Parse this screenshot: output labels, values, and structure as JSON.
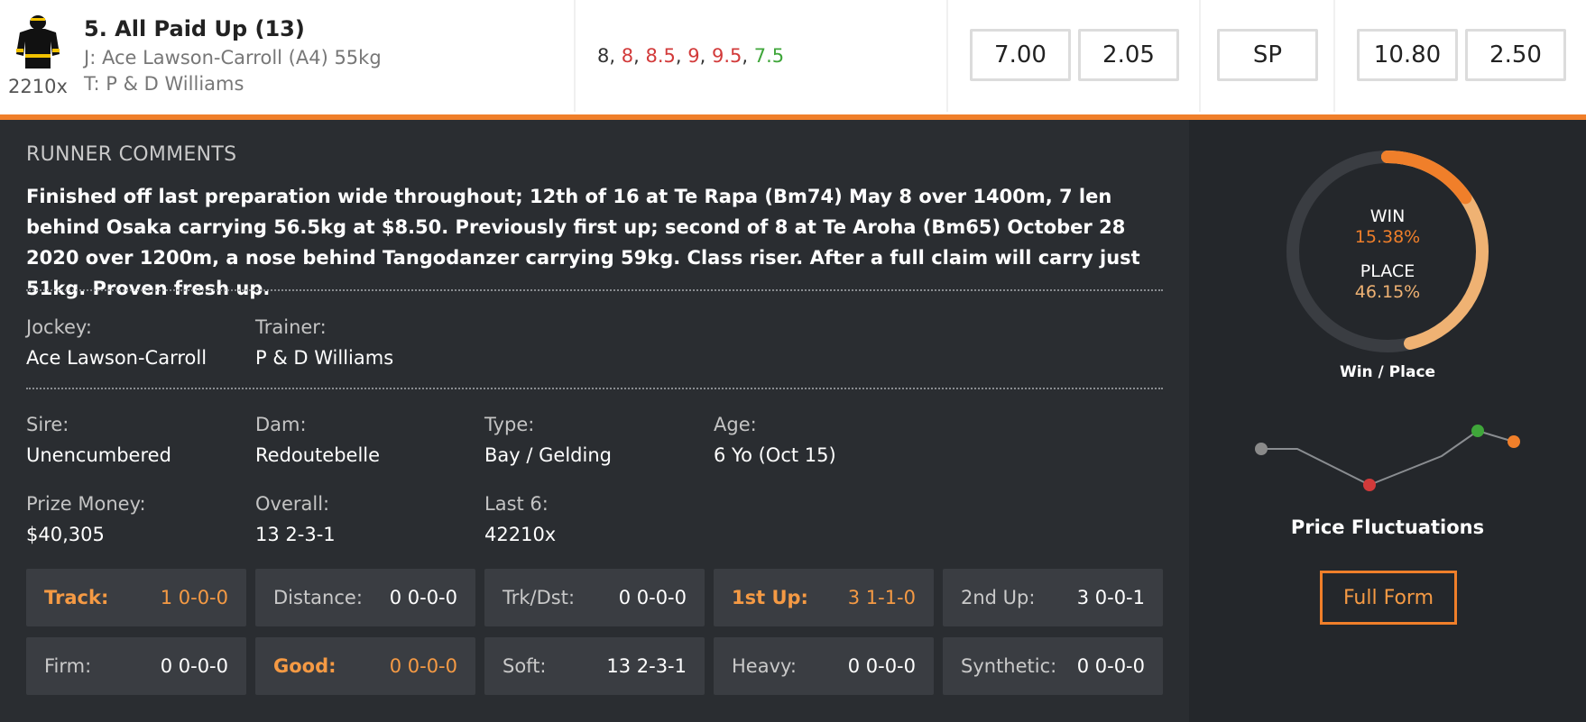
{
  "runner": {
    "name": "5. All Paid Up (13)",
    "jockey_line": "J: Ace Lawson-Carroll (A4) 55kg",
    "trainer_line": "T: P & D Williams",
    "silk_form": "2210x"
  },
  "flucs": [
    {
      "value": "8",
      "color": "#333333"
    },
    {
      "value": "8",
      "color": "#d23a3a"
    },
    {
      "value": "8.5",
      "color": "#d23a3a"
    },
    {
      "value": "9",
      "color": "#d23a3a"
    },
    {
      "value": "9.5",
      "color": "#d23a3a"
    },
    {
      "value": "7.5",
      "color": "#3fa63a"
    }
  ],
  "odds": {
    "fixed_win": "7.00",
    "fixed_place": "2.05",
    "sp": "SP",
    "tote_win": "10.80",
    "tote_place": "2.50"
  },
  "comments": {
    "title": "RUNNER COMMENTS",
    "text": "Finished off last preparation wide throughout; 12th of 16 at Te Rapa (Bm74) May 8 over 1400m, 7 len behind Osaka carrying 56.5kg at $8.50. Previously first up; second of 8 at Te Aroha (Bm65) October 28 2020 over 1200m, a nose behind Tangodanzer carrying 59kg. Class riser. After a full claim will carry just 51kg. Proven fresh up."
  },
  "people": {
    "jockey_label": "Jockey:",
    "jockey": "Ace Lawson-Carroll",
    "trainer_label": "Trainer:",
    "trainer": "P & D Williams"
  },
  "profile": {
    "sire_label": "Sire:",
    "sire": "Unencumbered",
    "dam_label": "Dam:",
    "dam": "Redoutebelle",
    "type_label": "Type:",
    "type": "Bay / Gelding",
    "age_label": "Age:",
    "age": "6 Yo (Oct 15)",
    "prize_label": "Prize Money:",
    "prize": "$40,305",
    "overall_label": "Overall:",
    "overall": "13 2-3-1",
    "last6_label": "Last 6:",
    "last6": "42210x"
  },
  "stats": [
    {
      "label": "Track:",
      "value": "1 0-0-0",
      "highlight": true
    },
    {
      "label": "Distance:",
      "value": "0 0-0-0",
      "highlight": false
    },
    {
      "label": "Trk/Dst:",
      "value": "0 0-0-0",
      "highlight": false
    },
    {
      "label": "1st Up:",
      "value": "3 1-1-0",
      "highlight": true
    },
    {
      "label": "2nd Up:",
      "value": "3 0-0-1",
      "highlight": false
    },
    {
      "label": "Firm:",
      "value": "0 0-0-0",
      "highlight": false
    },
    {
      "label": "Good:",
      "value": "0 0-0-0",
      "highlight": true
    },
    {
      "label": "Soft:",
      "value": "13 2-3-1",
      "highlight": false
    },
    {
      "label": "Heavy:",
      "value": "0 0-0-0",
      "highlight": false
    },
    {
      "label": "Synthetic:",
      "value": "0 0-0-0",
      "highlight": false
    }
  ],
  "win_place": {
    "win_label": "WIN",
    "win_value": "15.38%",
    "win_fraction": 0.1538,
    "place_label": "PLACE",
    "place_value": "46.15%",
    "place_fraction": 0.4615,
    "caption": "Win / Place"
  },
  "price_fluctuations": {
    "caption": "Price Fluctuations",
    "points": [
      8,
      8,
      8.5,
      9,
      8.6,
      8.2,
      7.5,
      7.8
    ],
    "marker_colors": {
      "start": "#8a8a8a",
      "max": "#d23a3a",
      "min": "#3fa63a",
      "end": "#f07f2a"
    }
  },
  "actions": {
    "full_form": "Full Form"
  },
  "colors": {
    "accent": "#f07f2a",
    "highlight_text": "#f59a44",
    "place_arc": "#efb273"
  }
}
